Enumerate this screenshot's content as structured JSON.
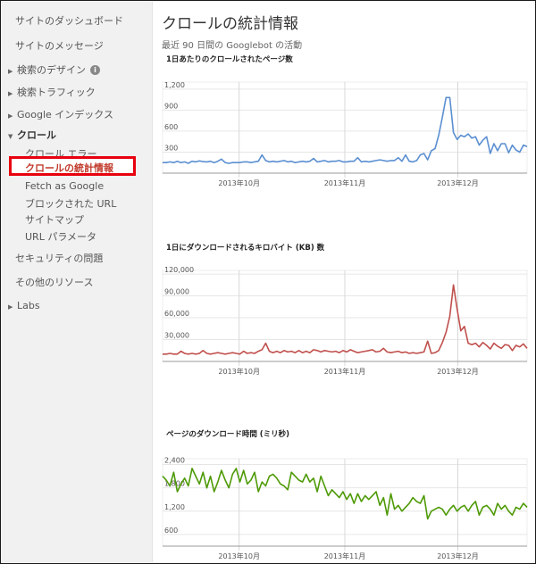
{
  "sidebar": {
    "items": [
      {
        "label": "サイトのダッシュボード"
      },
      {
        "label": "サイトのメッセージ"
      },
      {
        "label": "検索のデザイン",
        "has_info": true
      },
      {
        "label": "検索トラフィック"
      },
      {
        "label": "Google インデックス"
      },
      {
        "label": "クロール"
      },
      {
        "label": "クロール エラー"
      },
      {
        "label": "クロールの統計情報",
        "active": true
      },
      {
        "label": "Fetch as Google"
      },
      {
        "label": "ブロックされた URL"
      },
      {
        "label": "サイトマップ"
      },
      {
        "label": "URL パラメータ"
      },
      {
        "label": "セキュリティの問題"
      },
      {
        "label": "その他のリソース"
      },
      {
        "label": "Labs"
      }
    ],
    "info_icon": "i",
    "accent_color": "#e8000e"
  },
  "main": {
    "title": "クロールの統計情報",
    "subtitle": "最近 90 日間の Googlebot の活動"
  },
  "chart_data": [
    {
      "type": "line",
      "title": "1日あたりのクロールされたページ数",
      "color": "#5b8fd1",
      "x_ticks": [
        "2013年10月",
        "2013年11月",
        "2013年12月"
      ],
      "y_ticks": [
        300,
        600,
        900,
        1200
      ],
      "ylim": [
        0,
        1300
      ],
      "values": [
        150,
        150,
        160,
        150,
        170,
        150,
        160,
        140,
        170,
        160,
        175,
        165,
        160,
        170,
        150,
        170,
        200,
        150,
        140,
        150,
        150,
        150,
        160,
        160,
        150,
        160,
        170,
        260,
        180,
        160,
        170,
        160,
        170,
        180,
        160,
        170,
        150,
        160,
        170,
        160,
        170,
        210,
        160,
        170,
        180,
        160,
        170,
        170,
        180,
        160,
        160,
        170,
        170,
        220,
        160,
        170,
        160,
        170,
        180,
        190,
        180,
        170,
        180,
        180,
        220,
        170,
        260,
        170,
        160,
        180,
        260,
        280,
        190,
        320,
        350,
        540,
        800,
        1080,
        1080,
        580,
        480,
        540,
        520,
        560,
        500,
        520,
        400,
        470,
        520,
        280,
        420,
        320,
        420,
        420,
        290,
        400,
        330,
        300,
        400,
        380
      ]
    },
    {
      "type": "line",
      "title": "1日にダウンロードされるキロバイト (KB) 数",
      "color": "#c0504d",
      "x_ticks": [
        "2013年10月",
        "2013年11月",
        "2013年12月"
      ],
      "y_ticks": [
        30000,
        60000,
        90000,
        120000
      ],
      "ylim": [
        0,
        125000
      ],
      "values": [
        10000,
        10000,
        11000,
        10000,
        10000,
        14000,
        11000,
        10000,
        11000,
        10000,
        11000,
        15000,
        11000,
        10000,
        11000,
        12000,
        11000,
        10000,
        11000,
        12000,
        11000,
        10000,
        14000,
        11000,
        12000,
        11000,
        14000,
        16000,
        25000,
        14000,
        12000,
        14000,
        12000,
        15000,
        13000,
        14000,
        12000,
        15000,
        12000,
        14000,
        12000,
        16000,
        15000,
        13000,
        15000,
        14000,
        13000,
        14000,
        12000,
        15000,
        13000,
        16000,
        14000,
        12000,
        13000,
        14000,
        15000,
        16000,
        13000,
        14000,
        18000,
        13000,
        12000,
        13000,
        14000,
        12000,
        13000,
        11000,
        12000,
        11000,
        12000,
        13000,
        28000,
        11000,
        12000,
        15000,
        26000,
        40000,
        62000,
        105000,
        72000,
        42000,
        48000,
        25000,
        23000,
        25000,
        20000,
        26000,
        22000,
        17000,
        25000,
        21000,
        18000,
        23000,
        22000,
        15000,
        22000,
        20000,
        24000,
        18000
      ]
    },
    {
      "type": "line",
      "title": "ページのダウンロード時間 (ミリ秒)",
      "color": "#4e9a06",
      "x_ticks": [
        "2013年10月",
        "2013年11月",
        "2013年12月"
      ],
      "y_ticks": [
        600,
        1200,
        1800,
        2400
      ],
      "ylim": [
        300,
        2550
      ],
      "values": [
        2100,
        2000,
        1850,
        2200,
        1700,
        1900,
        2050,
        1850,
        2300,
        2100,
        1900,
        2200,
        1800,
        2100,
        1700,
        1950,
        2250,
        2000,
        1800,
        2150,
        2300,
        1950,
        2250,
        1900,
        2000,
        2200,
        1700,
        1950,
        1850,
        2100,
        2150,
        2050,
        1900,
        1850,
        1750,
        2200,
        2100,
        2000,
        1950,
        2150,
        1950,
        2050,
        1700,
        2100,
        1850,
        1600,
        1750,
        1650,
        1550,
        1700,
        1500,
        1650,
        1400,
        1650,
        1450,
        1600,
        1500,
        1600,
        1700,
        1350,
        1550,
        1100,
        1650,
        1250,
        1350,
        1200,
        1300,
        1400,
        1550,
        1450,
        1400,
        1600,
        1000,
        1200,
        1250,
        1300,
        1250,
        1100,
        1250,
        1350,
        1200,
        1300,
        1350,
        1200,
        1350,
        1450,
        1100,
        1300,
        1350,
        1250,
        1100,
        1400,
        1250,
        1350,
        1200,
        1100,
        1300,
        1250,
        1400,
        1300
      ]
    }
  ]
}
